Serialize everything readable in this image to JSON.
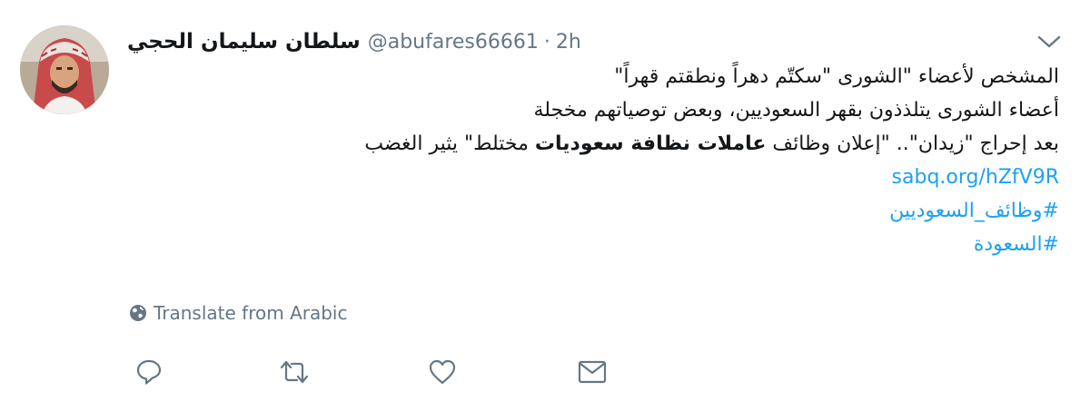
{
  "tweet": {
    "author": {
      "display_name": "سلطان سليمان الحجي",
      "handle": "@abufares66661",
      "separator": "·",
      "time": "2h",
      "avatar_icon": "user-avatar-photo"
    },
    "menu_icon": "chevron-down-icon",
    "text_lines": [
      "المشخص لأعضاء \"الشورى \"سكتّم دهراً ونطقتم قهراً\"",
      "أعضاء الشورى يتلذذون بقهر السعوديين، وبعض توصياتهم مخجلة"
    ],
    "line3": {
      "part1": "بعد إحراج \"زيدان\".. \"إعلان وظائف ",
      "bold": "عاملات نظافة سعوديات",
      "part2": " مختلط\" يثير الغضب"
    },
    "link_url": "sabq.org/hZfV9R",
    "hashtags": [
      "#وظائف_السعوديين",
      "#السعودة"
    ],
    "translate_label": "Translate from Arabic",
    "translate_icon": "globe-icon",
    "actions": [
      {
        "name": "reply",
        "icon": "reply-icon"
      },
      {
        "name": "retweet",
        "icon": "retweet-icon"
      },
      {
        "name": "like",
        "icon": "heart-icon"
      },
      {
        "name": "message",
        "icon": "envelope-icon"
      }
    ],
    "colors": {
      "text": "#14171a",
      "secondary": "#657786",
      "link": "#1da1f2",
      "background": "#ffffff"
    }
  }
}
